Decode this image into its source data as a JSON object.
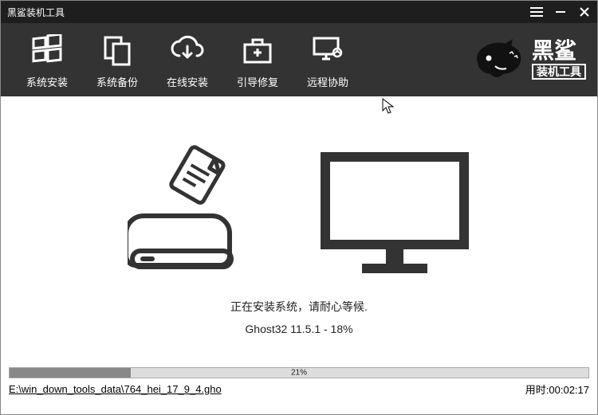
{
  "app_title": "黑鲨装机工具",
  "title_controls": {
    "menu": "menu",
    "min": "min",
    "close": "close"
  },
  "toolbar": {
    "items": [
      {
        "label": "系统安装",
        "icon": "windows"
      },
      {
        "label": "系统备份",
        "icon": "copy"
      },
      {
        "label": "在线安装",
        "icon": "cloud_download"
      },
      {
        "label": "引导修复",
        "icon": "first_aid"
      },
      {
        "label": "远程协助",
        "icon": "remote_monitor"
      }
    ]
  },
  "brand": {
    "name_big": "黑鲨",
    "name_small": "装机工具"
  },
  "status": {
    "installing_text": "正在安装系统，请耐心等候.",
    "ghost_line": "Ghost32 11.5.1 - 18%"
  },
  "progress": {
    "percent": 21,
    "percent_label": "21%"
  },
  "footer": {
    "path": "E:\\win_down_tools_data\\764_hei_17_9_4.gho",
    "elapsed_label": "用时:",
    "elapsed_value": "00:02:17"
  }
}
